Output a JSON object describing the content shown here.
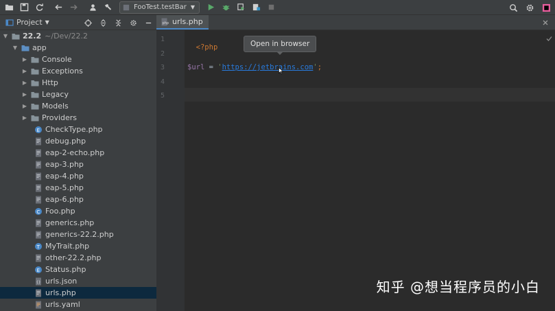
{
  "toolbar": {
    "run_config_label": "FooTest.testBar"
  },
  "project_panel": {
    "title": "Project"
  },
  "tree": {
    "root": {
      "label": "22.2",
      "hint": "~/Dev/22.2"
    },
    "app": {
      "label": "app"
    },
    "folders": [
      "Console",
      "Exceptions",
      "Http",
      "Legacy",
      "Models",
      "Providers"
    ],
    "files": [
      {
        "label": "CheckType.php",
        "icon": "php-enum-icon"
      },
      {
        "label": "debug.php",
        "icon": "php-file-icon"
      },
      {
        "label": "eap-2-echo.php",
        "icon": "php-file-icon"
      },
      {
        "label": "eap-3.php",
        "icon": "php-file-icon"
      },
      {
        "label": "eap-4.php",
        "icon": "php-file-icon"
      },
      {
        "label": "eap-5.php",
        "icon": "php-file-icon"
      },
      {
        "label": "eap-6.php",
        "icon": "php-file-icon"
      },
      {
        "label": "Foo.php",
        "icon": "php-class-icon"
      },
      {
        "label": "generics.php",
        "icon": "php-file-icon"
      },
      {
        "label": "generics-22.2.php",
        "icon": "php-file-icon"
      },
      {
        "label": "MyTrait.php",
        "icon": "php-trait-icon"
      },
      {
        "label": "other-22.2.php",
        "icon": "php-file-icon"
      },
      {
        "label": "Status.php",
        "icon": "php-enum-icon"
      },
      {
        "label": "urls.json",
        "icon": "json-file-icon"
      },
      {
        "label": "urls.php",
        "icon": "php-file-icon"
      },
      {
        "label": "urls.yaml",
        "icon": "yaml-file-icon"
      }
    ]
  },
  "editor": {
    "tab_label": "urls.php",
    "line_numbers": [
      "1",
      "2",
      "3",
      "4",
      "5"
    ],
    "code": {
      "line1": "<?php",
      "var": "$url",
      "op": " = ",
      "quote_open": "'",
      "url": "https://jetbrains.com",
      "quote_close": "'",
      "semi": ";"
    },
    "tooltip": "Open in browser"
  },
  "watermark": "知乎 @想当程序员的小白",
  "colors": {
    "background": "#2b2b2b",
    "panel": "#3c3f41",
    "selection": "#0d293e",
    "accent": "#4a88c7",
    "link": "#287bde"
  }
}
